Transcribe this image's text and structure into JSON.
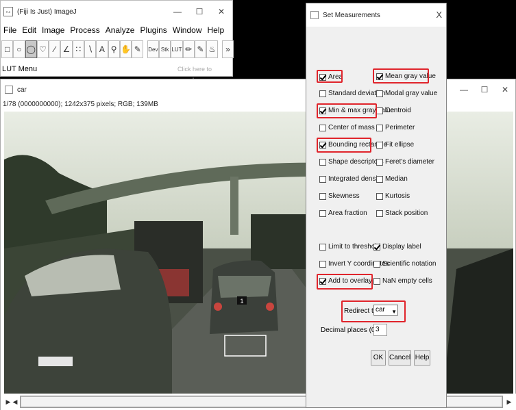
{
  "fiji": {
    "title": "(Fiji Is Just) ImageJ",
    "icon_letters": "FIJI",
    "menus": [
      "File",
      "Edit",
      "Image",
      "Process",
      "Analyze",
      "Plugins",
      "Window",
      "Help"
    ],
    "toolbar": {
      "dev": "Dev",
      "stk": "Stk",
      "lut": "LUT",
      "overflow": "»"
    },
    "status": "LUT Menu",
    "search_placeholder": "Click here to search"
  },
  "image_window": {
    "title": "car",
    "info": "1/78 (0000000000); 1242x375 pixels; RGB; 139MB",
    "roi_label": "1"
  },
  "dialog": {
    "title": "Set Measurements",
    "close": "X",
    "checkboxes": [
      {
        "label": "Area",
        "checked": true
      },
      {
        "label": "Mean gray value",
        "checked": true
      },
      {
        "label": "Standard deviation",
        "checked": false
      },
      {
        "label": "Modal gray value",
        "checked": false
      },
      {
        "label": "Min & max gray value",
        "checked": true
      },
      {
        "label": "Centroid",
        "checked": false
      },
      {
        "label": "Center of mass",
        "checked": false
      },
      {
        "label": "Perimeter",
        "checked": false
      },
      {
        "label": "Bounding rectangle",
        "checked": true
      },
      {
        "label": "Fit ellipse",
        "checked": false
      },
      {
        "label": "Shape descriptors",
        "checked": false
      },
      {
        "label": "Feret's diameter",
        "checked": false
      },
      {
        "label": "Integrated density",
        "checked": false
      },
      {
        "label": "Median",
        "checked": false
      },
      {
        "label": "Skewness",
        "checked": false
      },
      {
        "label": "Kurtosis",
        "checked": false
      },
      {
        "label": "Area fraction",
        "checked": false
      },
      {
        "label": "Stack position",
        "checked": false
      },
      {
        "label": "Limit to threshold",
        "checked": false
      },
      {
        "label": "Display label",
        "checked": true
      },
      {
        "label": "Invert Y coordinates",
        "checked": false
      },
      {
        "label": "Scientific notation",
        "checked": false
      },
      {
        "label": "Add to overlay",
        "checked": true
      },
      {
        "label": "NaN empty cells",
        "checked": false
      }
    ],
    "redirect_label": "Redirect to:",
    "redirect_value": "car",
    "decimal_label": "Decimal places (0-9):",
    "decimal_value": "3",
    "buttons": {
      "ok": "OK",
      "cancel": "Cancel",
      "help": "Help"
    }
  },
  "colors": {
    "highlight": "#e0242b",
    "dialog_bg": "#f0f0f0"
  }
}
